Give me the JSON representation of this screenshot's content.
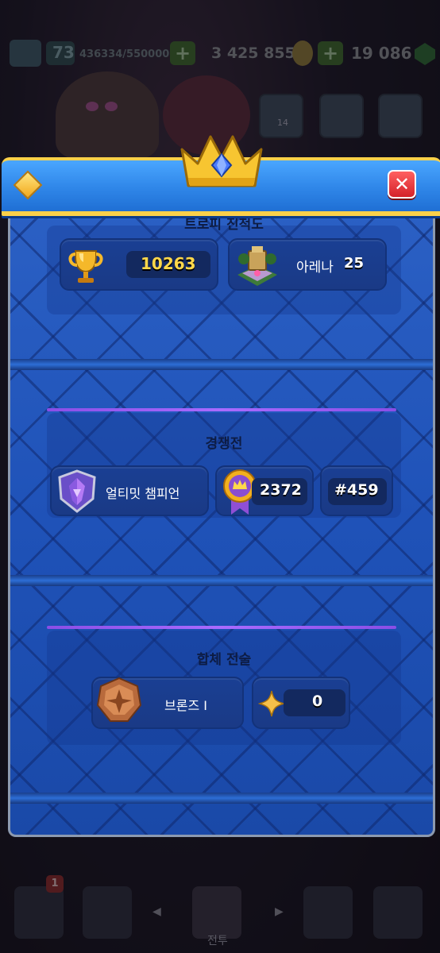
{
  "background": {
    "level": "73",
    "xp": "436334/550000",
    "gold": "3 425 855",
    "gems": "19 086",
    "friends_count": "14",
    "notification_count": "1",
    "nav_label": "전투"
  },
  "modal": {
    "trophy_road": {
      "title": "트로피 진척도",
      "trophies": "10263",
      "arena_label": "아레나",
      "arena_number": "25"
    },
    "ranked": {
      "title": "경쟁전",
      "league": "얼티밋 챔피언",
      "rating": "2372",
      "rank": "#459"
    },
    "merge_tactics": {
      "title": "합체 전술",
      "league": "브론즈 I",
      "stars": "0"
    }
  },
  "colors": {
    "header_blue": "#2f86e8",
    "gold_trim": "#fbd14a",
    "panel_blue": "#1d4fae",
    "purple_line": "#a96bff",
    "close_red": "#d4222a"
  }
}
